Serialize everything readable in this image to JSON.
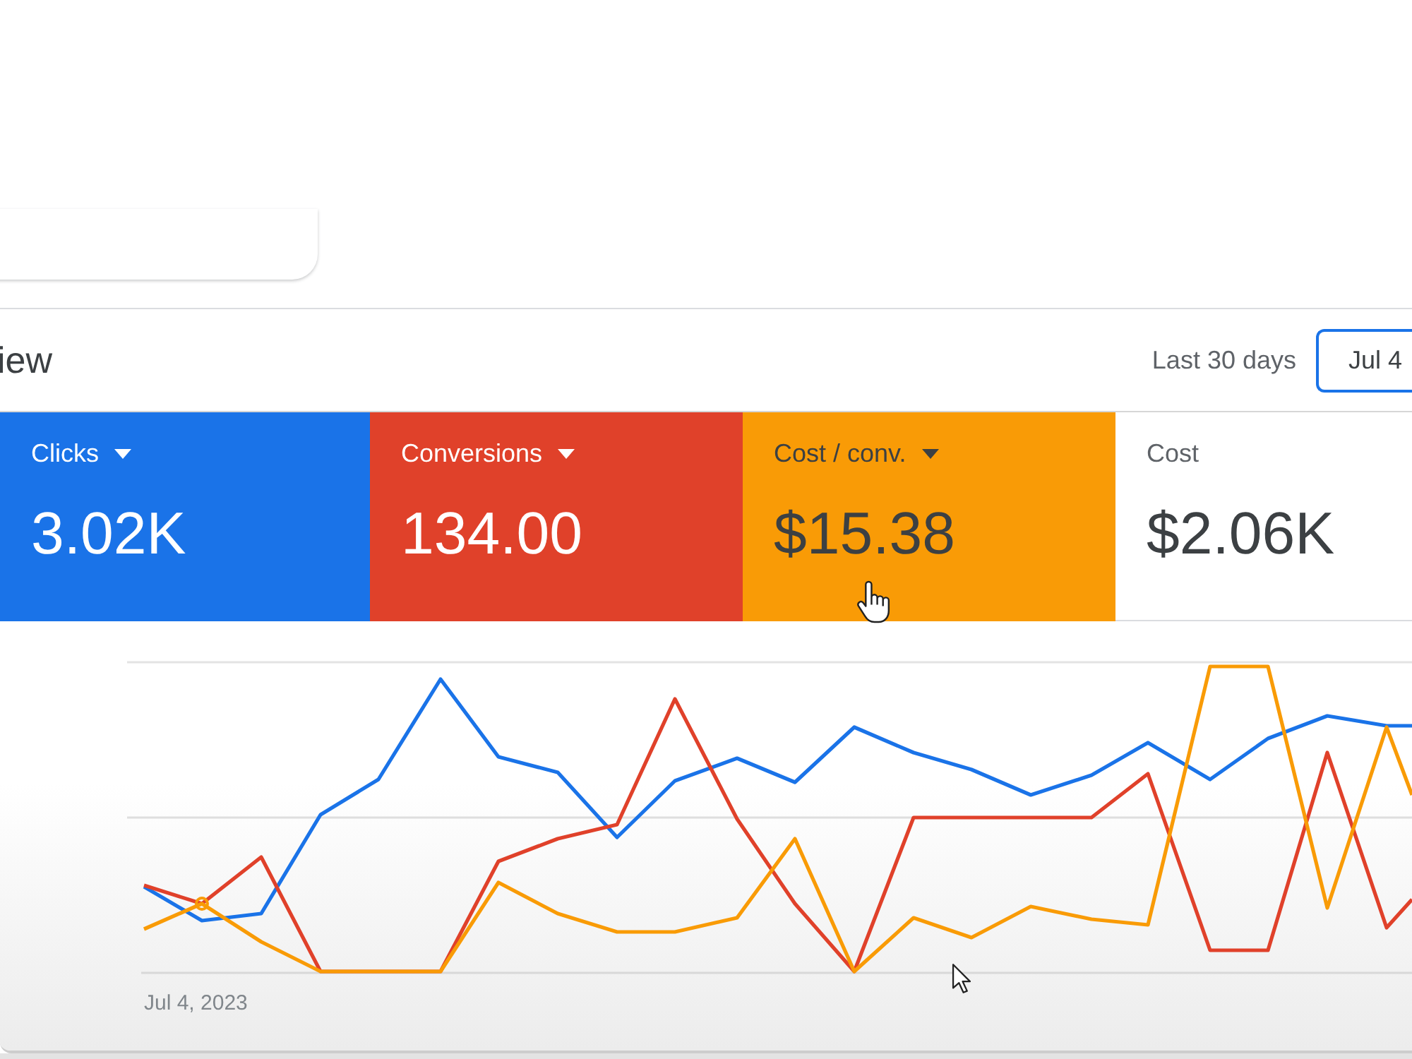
{
  "panel": {
    "title": "iew",
    "date_range_label": "Last 30 days",
    "date_button": "Jul 4"
  },
  "metrics": [
    {
      "label": "Clicks",
      "value": "3.02K",
      "selected": true,
      "color": "#1a73e8"
    },
    {
      "label": "Conversions",
      "value": "134.00",
      "selected": true,
      "color": "#e0412a"
    },
    {
      "label": "Cost / conv.",
      "value": "$15.38",
      "selected": true,
      "color": "#f99b06"
    },
    {
      "label": "Cost",
      "value": "$2.06K",
      "selected": false
    }
  ],
  "chart": {
    "x_label": "Jul 4, 2023"
  }
}
